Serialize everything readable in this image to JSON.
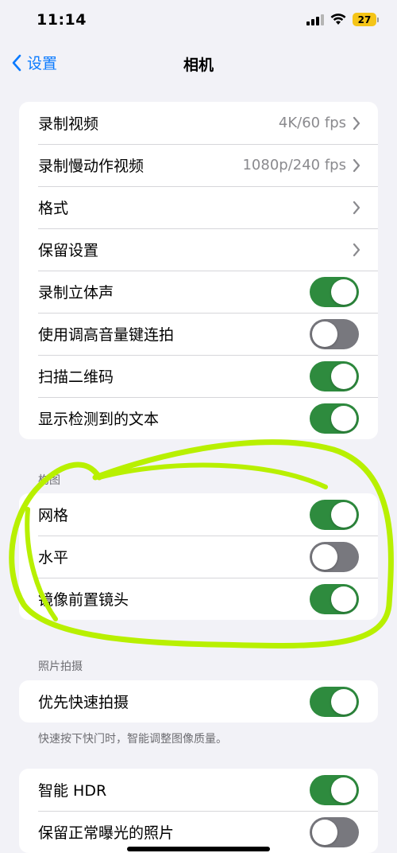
{
  "status": {
    "time": "11:14",
    "battery": "27"
  },
  "nav": {
    "back_label": "设置",
    "title": "相机"
  },
  "group1": [
    {
      "label": "录制视频",
      "value": "4K/60 fps",
      "type": "link"
    },
    {
      "label": "录制慢动作视频",
      "value": "1080p/240 fps",
      "type": "link"
    },
    {
      "label": "格式",
      "type": "link"
    },
    {
      "label": "保留设置",
      "type": "link"
    },
    {
      "label": "录制立体声",
      "type": "toggle",
      "on": true
    },
    {
      "label": "使用调高音量键连拍",
      "type": "toggle",
      "on": false
    },
    {
      "label": "扫描二维码",
      "type": "toggle",
      "on": true
    },
    {
      "label": "显示检测到的文本",
      "type": "toggle",
      "on": true
    }
  ],
  "composition": {
    "header": "构图",
    "items": [
      {
        "label": "网格",
        "on": true
      },
      {
        "label": "水平",
        "on": false
      },
      {
        "label": "镜像前置镜头",
        "on": true
      }
    ]
  },
  "photo": {
    "header": "照片拍摄",
    "items": [
      {
        "label": "优先快速拍摄",
        "on": true
      }
    ],
    "footer": "快速按下快门时，智能调整图像质量。"
  },
  "hdr": {
    "items": [
      {
        "label": "智能 HDR",
        "on": true
      },
      {
        "label": "保留正常曝光的照片",
        "on": false
      }
    ]
  },
  "colors": {
    "accent": "#0a7aff",
    "toggle_on": "#2e8b3e",
    "toggle_off": "#78787e",
    "annotation": "#b8f000"
  }
}
